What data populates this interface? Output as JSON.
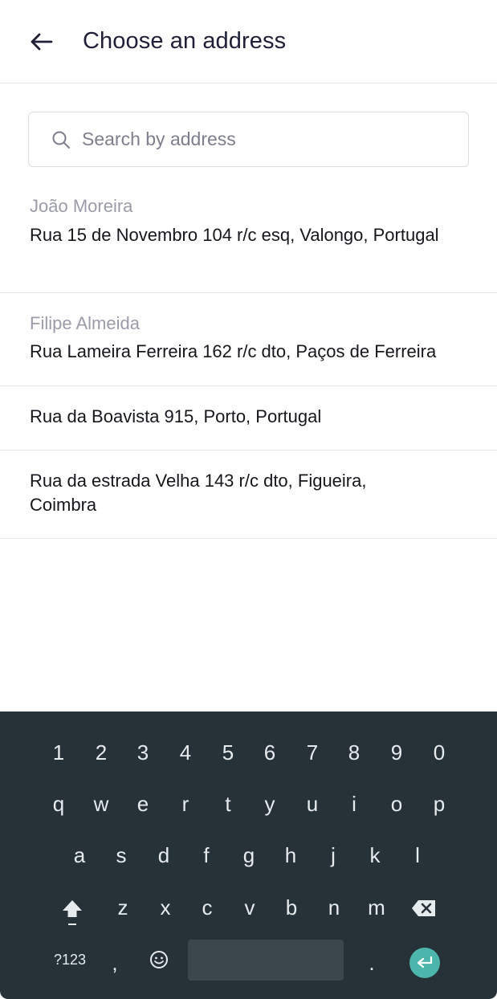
{
  "header": {
    "back_icon": "arrow-left-icon",
    "title": "Choose an address"
  },
  "search": {
    "icon": "search-icon",
    "placeholder": "Search by address",
    "value": ""
  },
  "addresses": [
    {
      "name": "João Moreira",
      "address": "Rua 15 de Novembro 104 r/c esq, Valongo, Portugal"
    },
    {
      "name": "Filipe Almeida",
      "address": "Rua Lameira Ferreira 162 r/c dto, Paços de Ferreira"
    },
    {
      "name": "",
      "address": "Rua da Boavista 915, Porto, Portugal"
    },
    {
      "name": "",
      "address": "Rua da estrada Velha 143 r/c dto, Figueira, Coimbra"
    }
  ],
  "keyboard": {
    "row1": [
      "1",
      "2",
      "3",
      "4",
      "5",
      "6",
      "7",
      "8",
      "9",
      "0"
    ],
    "row2": [
      "q",
      "w",
      "e",
      "r",
      "t",
      "y",
      "u",
      "i",
      "o",
      "p"
    ],
    "row3": [
      "a",
      "s",
      "d",
      "f",
      "g",
      "h",
      "j",
      "k",
      "l"
    ],
    "row4": [
      "z",
      "x",
      "c",
      "v",
      "b",
      "n",
      "m"
    ],
    "symbols_label": "?123",
    "comma": ",",
    "period": ".",
    "shift_icon": "shift-icon",
    "backspace_icon": "backspace-icon",
    "emoji_icon": "emoji-icon",
    "enter_icon": "enter-icon",
    "background_color": "#263238",
    "enter_color": "#4db6ac"
  }
}
